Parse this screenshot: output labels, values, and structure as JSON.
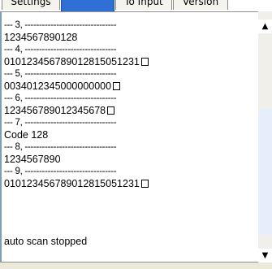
{
  "tabs": [
    {
      "label": "Settings"
    },
    {
      "label": ""
    },
    {
      "label": "To Input"
    },
    {
      "label": "Version"
    }
  ],
  "log": {
    "lines": [
      {
        "kind": "sep",
        "text": "--- 3, --------------------------------"
      },
      {
        "kind": "val",
        "text": "1234567890128",
        "box": false
      },
      {
        "kind": "sep",
        "text": "--- 4, --------------------------------"
      },
      {
        "kind": "val",
        "text": "0101234567890128150512​31",
        "box": true
      },
      {
        "kind": "sep",
        "text": "--- 5, --------------------------------"
      },
      {
        "kind": "val",
        "text": "0034012345000000000",
        "box": true
      },
      {
        "kind": "sep",
        "text": "--- 6, --------------------------------"
      },
      {
        "kind": "val",
        "text": "123456789012345678",
        "box": true
      },
      {
        "kind": "sep",
        "text": "--- 7, --------------------------------"
      },
      {
        "kind": "val",
        "text": "Code 128",
        "box": false
      },
      {
        "kind": "sep",
        "text": "--- 8, --------------------------------"
      },
      {
        "kind": "val",
        "text": "1234567890",
        "box": false
      },
      {
        "kind": "sep",
        "text": "--- 9, --------------------------------"
      },
      {
        "kind": "val",
        "text": "010123456789012815051231",
        "box": true
      }
    ],
    "status": "auto scan stopped"
  },
  "scrollbar": {
    "up_icon": "arrow-up-icon",
    "down_icon": "arrow-down-icon"
  }
}
